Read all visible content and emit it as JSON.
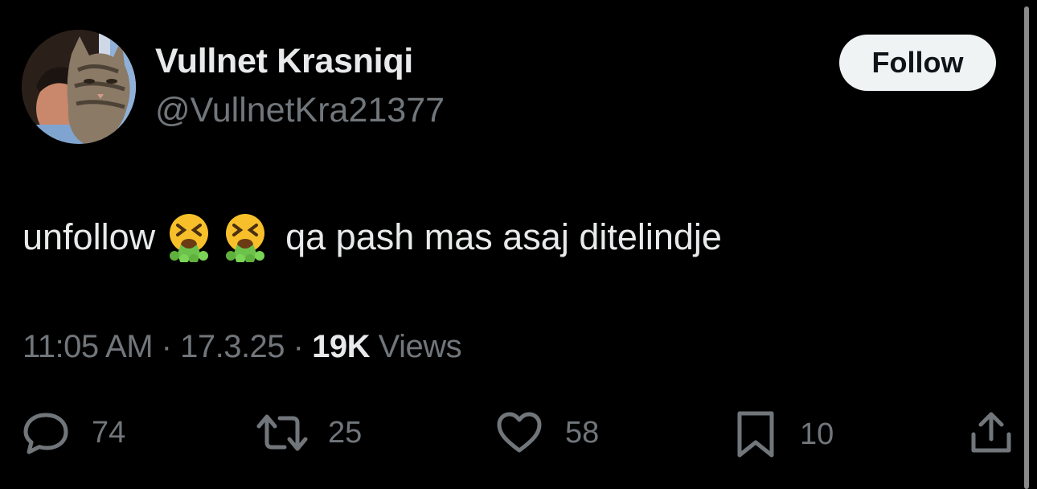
{
  "author": {
    "display_name": "Vullnet Krasniqi",
    "handle": "@VullnetKra21377"
  },
  "follow_button": {
    "label": "Follow"
  },
  "tweet": {
    "text_before": "unfollow",
    "emoji": [
      "nauseated-vomiting-face",
      "nauseated-vomiting-face"
    ],
    "text_after": "qa pash mas asaj ditelindje"
  },
  "meta": {
    "time": "11:05 AM",
    "sep1": " · ",
    "date": "17.3.25",
    "sep2": " · ",
    "views_count": "19K",
    "views_label": " Views"
  },
  "actions": {
    "replies": "74",
    "reposts": "25",
    "likes": "58",
    "bookmarks": "10"
  },
  "icons": {
    "reply": "reply-icon",
    "repost": "repost-icon",
    "like": "heart-icon",
    "bookmark": "bookmark-icon",
    "share": "share-icon"
  },
  "colors": {
    "background": "#000000",
    "text": "#e7e9ea",
    "secondary": "#71767b",
    "follow_bg": "#eff3f4"
  }
}
